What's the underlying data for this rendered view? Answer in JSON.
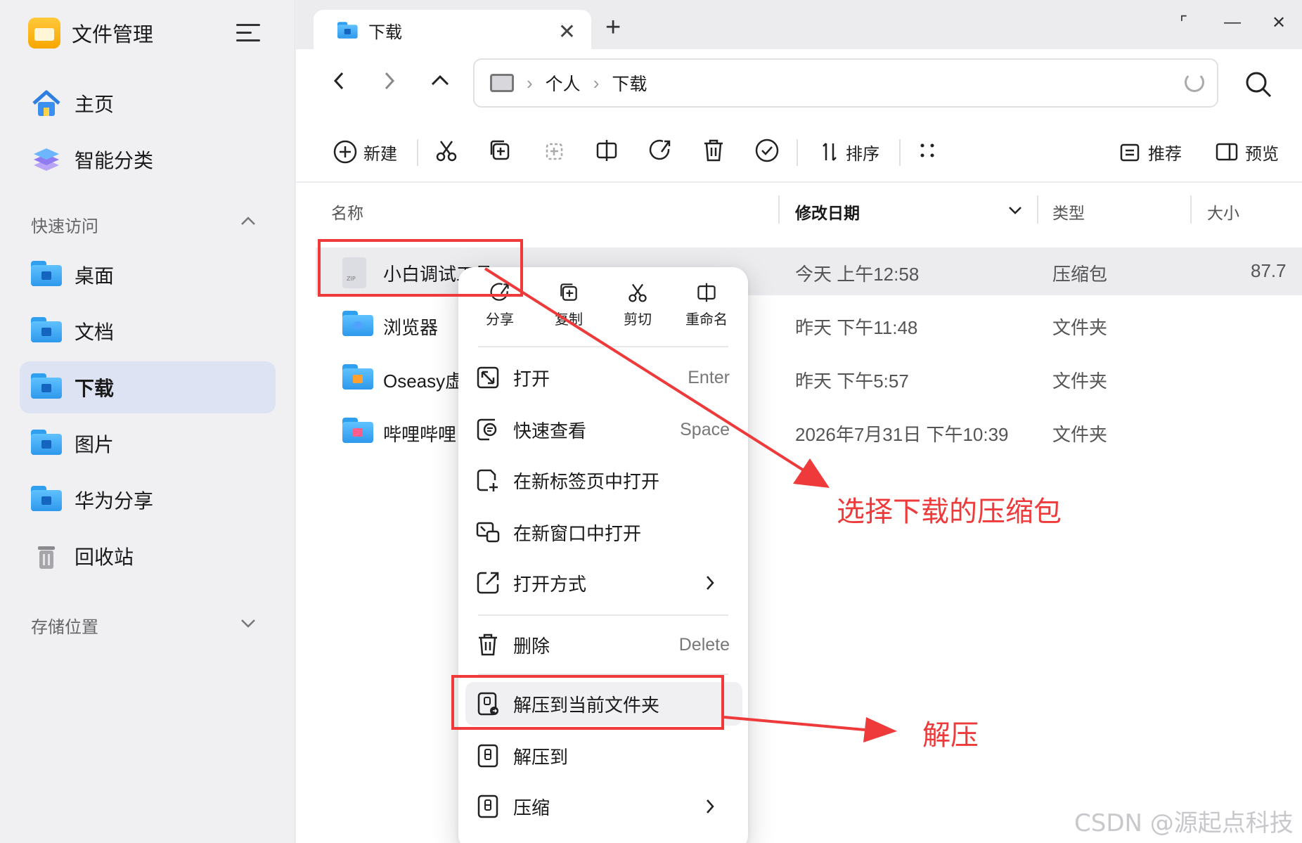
{
  "app": {
    "title": "文件管理"
  },
  "sidebar": {
    "home": "主页",
    "smart": "智能分类",
    "quick_access_label": "快速访问",
    "items": [
      {
        "label": "桌面"
      },
      {
        "label": "文档"
      },
      {
        "label": "下载"
      },
      {
        "label": "图片"
      },
      {
        "label": "华为分享"
      },
      {
        "label": "回收站"
      }
    ],
    "storage_label": "存储位置"
  },
  "tab": {
    "label": "下载"
  },
  "breadcrumb": {
    "items": [
      "个人",
      "下载"
    ]
  },
  "toolbar": {
    "new_label": "新建",
    "sort_label": "排序",
    "recommend_label": "推荐",
    "preview_label": "预览"
  },
  "columns": {
    "name": "名称",
    "date": "修改日期",
    "type": "类型",
    "size": "大小"
  },
  "files": [
    {
      "name": "小白调试工具",
      "date": "今天 上午12:58",
      "type": "压缩包",
      "size": "87.7"
    },
    {
      "name": "浏览器",
      "date": "昨天 下午11:48",
      "type": "文件夹",
      "size": ""
    },
    {
      "name": "Oseasy虚拟",
      "date": "昨天 下午5:57",
      "type": "文件夹",
      "size": ""
    },
    {
      "name": "哔哩哔哩",
      "date": "2026年7月31日 下午10:39",
      "type": "文件夹",
      "size": ""
    }
  ],
  "context_menu": {
    "top": [
      {
        "label": "分享",
        "icon": "share-icon"
      },
      {
        "label": "复制",
        "icon": "copy-icon"
      },
      {
        "label": "剪切",
        "icon": "cut-icon"
      },
      {
        "label": "重命名",
        "icon": "rename-icon"
      }
    ],
    "open": {
      "label": "打开",
      "key": "Enter"
    },
    "quick_view": {
      "label": "快速查看",
      "key": "Space"
    },
    "open_new_tab": {
      "label": "在新标签页中打开"
    },
    "open_new_window": {
      "label": "在新窗口中打开"
    },
    "open_with": {
      "label": "打开方式"
    },
    "delete": {
      "label": "删除",
      "key": "Delete"
    },
    "extract_here": {
      "label": "解压到当前文件夹"
    },
    "extract_to": {
      "label": "解压到"
    },
    "compress": {
      "label": "压缩"
    }
  },
  "annotations": {
    "select_zip": "选择下载的压缩包",
    "extract": "解压",
    "color": "#ee3a3a"
  },
  "watermark": "CSDN @源起点科技"
}
